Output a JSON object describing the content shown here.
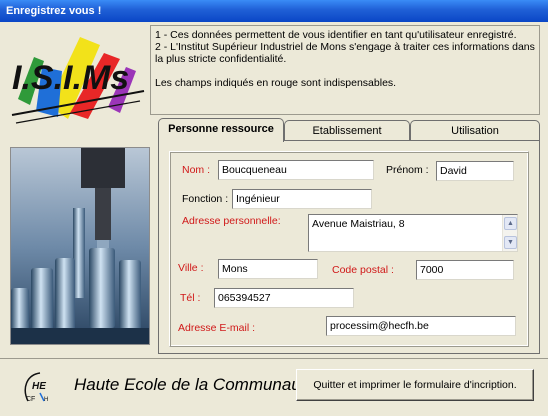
{
  "window": {
    "title": "Enregistrez vous !"
  },
  "logo": {
    "text": "I.S.I.Ms"
  },
  "info": {
    "line1": "1 - Ces données permettent de vous identifier en tant qu'utilisateur enregistré.",
    "line2": "2 - L'Institut Supérieur Industriel de Mons s'engage à traiter ces informations dans la plus stricte confidentialité.",
    "line3": "Les champs indiqués en rouge sont indispensables."
  },
  "tabs": [
    {
      "label": "Personne ressource",
      "active": true
    },
    {
      "label": "Etablissement",
      "active": false
    },
    {
      "label": "Utilisation",
      "active": false
    }
  ],
  "form": {
    "nom": {
      "label": "Nom :",
      "value": "Boucqueneau"
    },
    "prenom": {
      "label": "Prénom :",
      "value": "David"
    },
    "fonction": {
      "label": "Fonction :",
      "value": "Ingénieur"
    },
    "adresse": {
      "label": "Adresse personnelle:",
      "value": "Avenue Maistriau, 8"
    },
    "ville": {
      "label": "Ville :",
      "value": "Mons"
    },
    "code_postal": {
      "label": "Code postal :",
      "value": "7000"
    },
    "tel": {
      "label": "Tél :",
      "value": "065394527"
    },
    "email": {
      "label": "Adresse E-mail :",
      "value": "processim@hecfh.be"
    }
  },
  "footer": {
    "school_text": "Haute Ecole de la Communauté française du Hainaut",
    "quit_button": "Quitter et imprimer le formulaire d'incription."
  },
  "colors": {
    "title_bar": "#0a46c6",
    "required_label": "#d01818",
    "window_bg": "#ece9d8"
  }
}
